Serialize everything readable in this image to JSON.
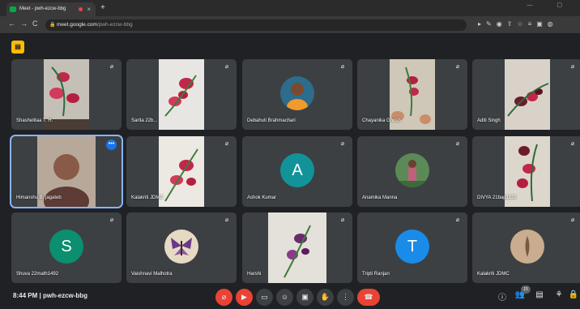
{
  "browser": {
    "tab_title": "Meet - pwh-ezcw-bbg",
    "new_tab_symbol": "+",
    "close_symbol": "×",
    "url_host": "meet.google.com",
    "url_path": "/pwh-ezcw-bbg"
  },
  "meeting": {
    "time": "8:44 PM",
    "separator": "|",
    "code": "pwh-ezcw-bbg",
    "participant_count": "15"
  },
  "participants": [
    {
      "name": "Shashelitaa T. H."
    },
    {
      "name": "Sarita 22b..."
    },
    {
      "name": "Debahuti Brahmachari"
    },
    {
      "name": "Chayanika Ghosh"
    },
    {
      "name": "Aditi Singh"
    },
    {
      "name": "Himanshu B. jagateb"
    },
    {
      "name": "Kalakriti JDMC"
    },
    {
      "name": "Ashok Kumar",
      "initial": "A",
      "color": "#12939a"
    },
    {
      "name": "Anamika Manna"
    },
    {
      "name": "DIVYA 21bap1122"
    },
    {
      "name": "Shuva 22math1492",
      "initial": "S",
      "color": "#0b8f6f"
    },
    {
      "name": "Vaishnavi Malhotra"
    },
    {
      "name": "Harshi"
    },
    {
      "name": "Tripti Ranjan",
      "initial": "T",
      "color": "#1a8be8"
    },
    {
      "name": "Kalakriti JDMC"
    }
  ],
  "colors": {
    "background": "#202124",
    "tile": "#3c4043",
    "end_call": "#ea4335",
    "active_outline": "#8ab4f8"
  }
}
